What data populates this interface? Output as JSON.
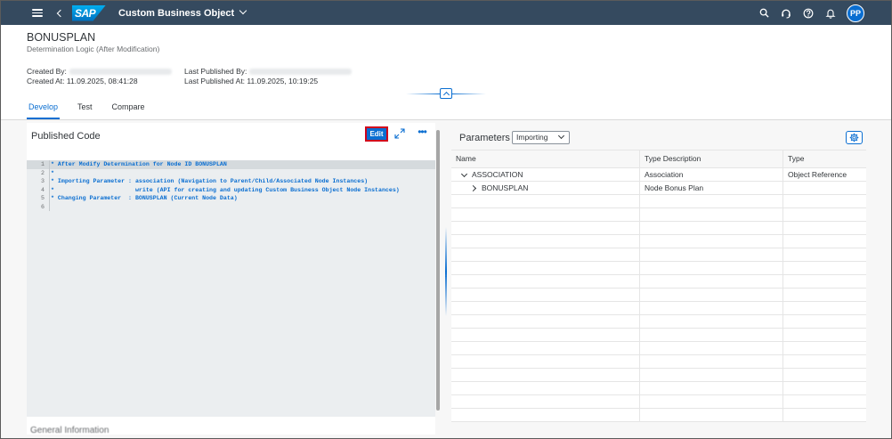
{
  "shell": {
    "logo_text": "SAP",
    "app_title": "Custom Business Object",
    "avatar_initials": "PP",
    "icons": [
      "menu-icon",
      "back-icon",
      "search-icon",
      "help-icon",
      "info-icon",
      "notification-icon"
    ]
  },
  "header": {
    "title": "BONUSPLAN",
    "subtitle": "Determination Logic (After Modification)",
    "created_by_label": "Created By:",
    "created_at_label": "Created At:",
    "created_at_value": "11.09.2025, 08:41:28",
    "last_published_by_label": "Last Published By:",
    "last_published_at_label": "Last Published At:",
    "last_published_at_value": "11.09.2025, 10:19:25"
  },
  "tabs": [
    {
      "label": "Develop",
      "active": true
    },
    {
      "label": "Test",
      "active": false
    },
    {
      "label": "Compare",
      "active": false
    }
  ],
  "code_panel": {
    "title": "Published Code",
    "edit_label": "Edit",
    "below_text": "General Information",
    "lines": [
      {
        "num": "1",
        "text": "* After Modify Determination for Node ID BONUSPLAN"
      },
      {
        "num": "2",
        "text": "*"
      },
      {
        "num": "3",
        "text": "* Importing Parameter : association (Navigation to Parent/Child/Associated Node Instances)"
      },
      {
        "num": "4",
        "text": "*                       write (API for creating and updating Custom Business Object Node Instances)"
      },
      {
        "num": "5",
        "text": "* Changing Parameter  : BONUSPLAN (Current Node Data)"
      },
      {
        "num": "6",
        "text": ""
      }
    ]
  },
  "params_panel": {
    "title": "Parameters",
    "select_value": "Importing",
    "columns": [
      "Name",
      "Type Description",
      "Type"
    ],
    "rows": [
      {
        "name": "ASSOCIATION",
        "desc": "Association",
        "type": "Object Reference"
      },
      {
        "name": "BONUSPLAN",
        "desc": "Node Bonus Plan",
        "type": ""
      }
    ]
  },
  "colors": {
    "shell_bg": "#354a5f",
    "accent": "#0a6ed1",
    "edit_highlight": "#d0021b"
  }
}
